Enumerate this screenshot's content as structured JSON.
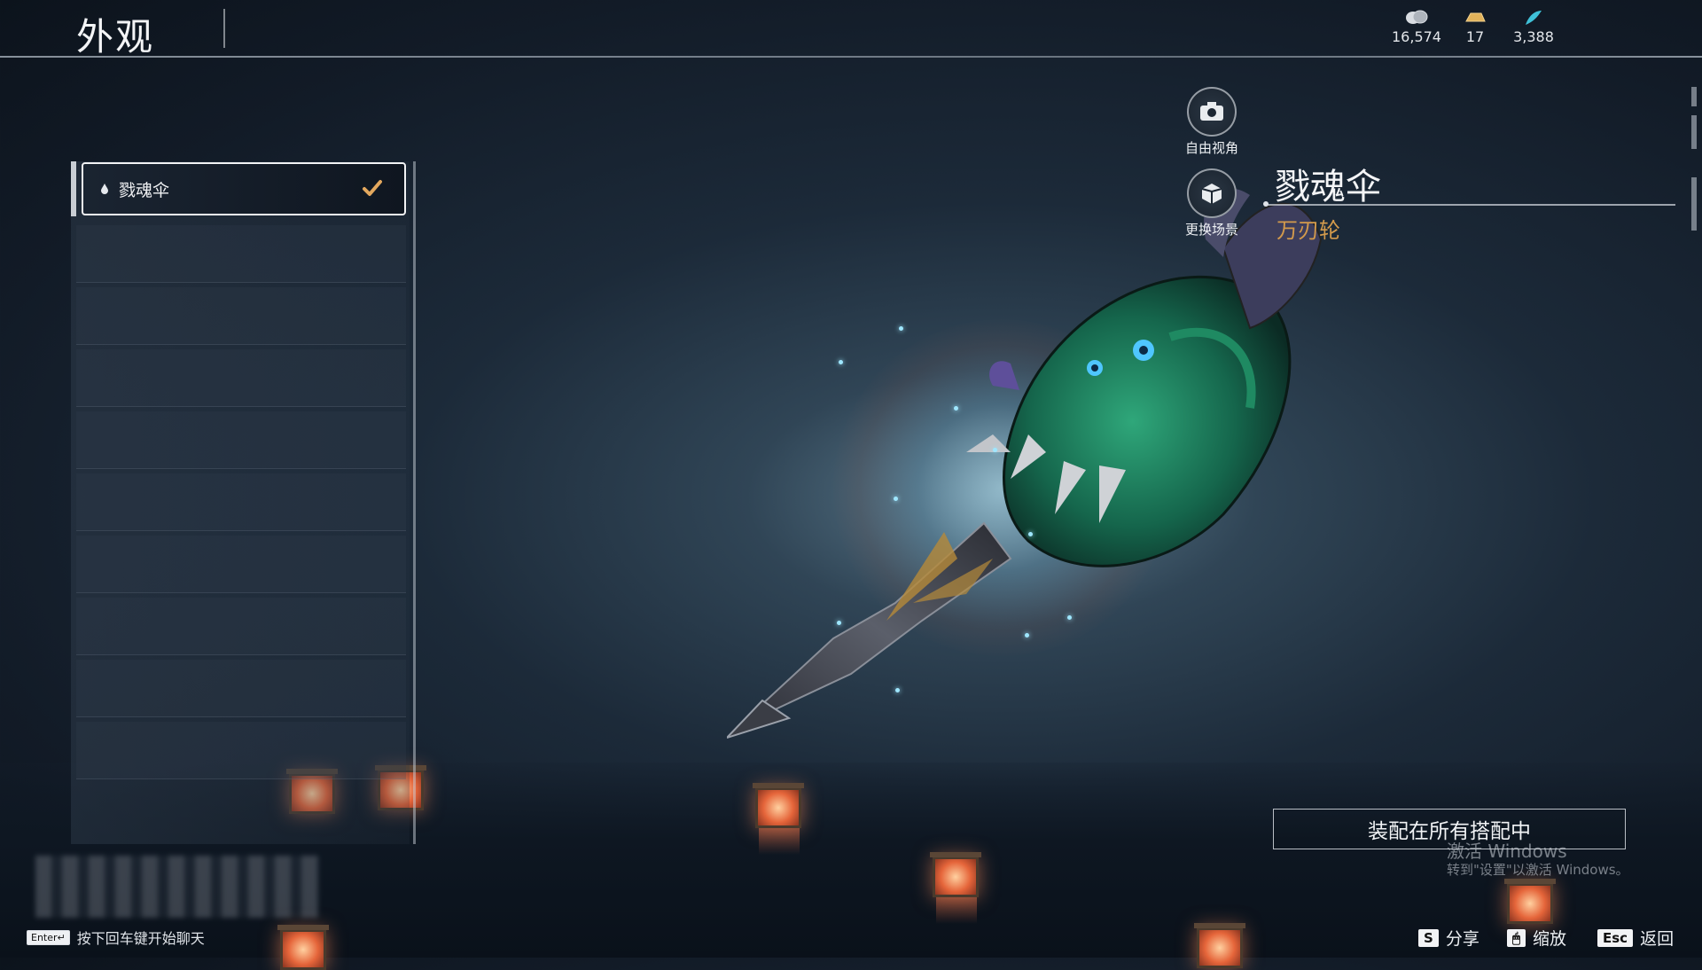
{
  "header": {
    "title": "外观"
  },
  "currencies": [
    {
      "icon": "coin-stack-icon",
      "value": "16,574"
    },
    {
      "icon": "gold-ingot-icon",
      "value": "17"
    },
    {
      "icon": "jade-feather-icon",
      "value": "3,388"
    }
  ],
  "skin_list": {
    "selected": {
      "label": "戮魂伞",
      "icon": "droplet-icon",
      "equipped": true
    }
  },
  "tools": [
    {
      "label": "自由视角",
      "icon": "camera-icon"
    },
    {
      "label": "更换场景",
      "icon": "scene-cube-icon"
    }
  ],
  "item": {
    "name": "戮魂伞",
    "weapon_type": "万刃轮"
  },
  "equip_button": {
    "label": "装配在所有搭配中"
  },
  "watermark": {
    "line1": "激活 Windows",
    "line2": "转到\"设置\"以激活 Windows。"
  },
  "chat": {
    "key": "Enter↵",
    "prompt": "按下回车键开始聊天"
  },
  "hints": [
    {
      "key": "S",
      "label": "分享"
    },
    {
      "key": "🖱",
      "label": "缩放"
    },
    {
      "key": "Esc",
      "label": "返回"
    }
  ],
  "colors": {
    "accent": "#d39a4c",
    "check": "#e3a85e",
    "background": "#1c2a39"
  }
}
